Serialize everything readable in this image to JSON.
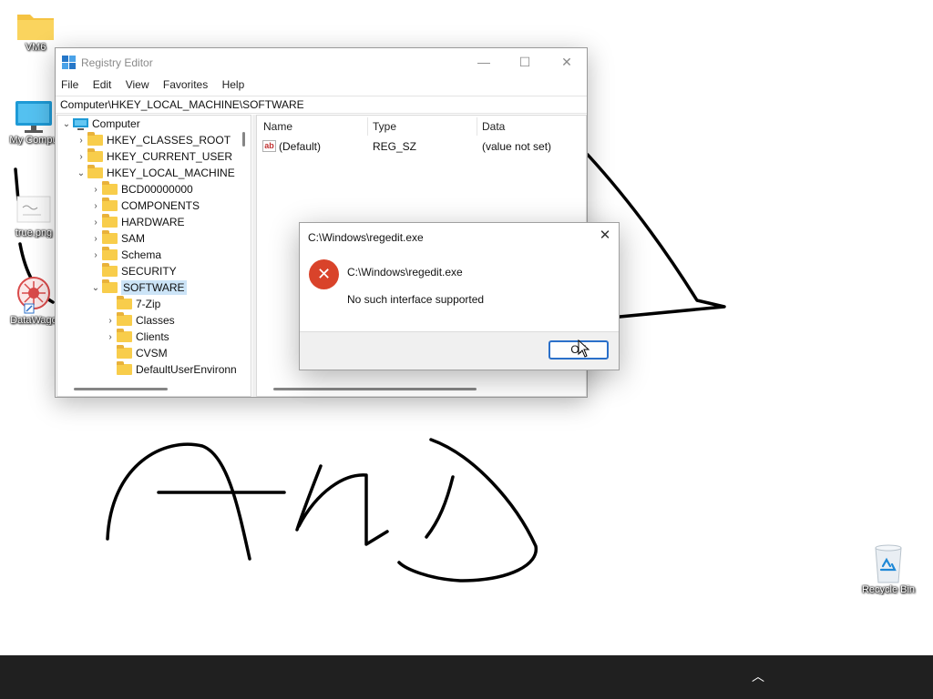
{
  "desktop": {
    "icons": [
      {
        "label": "VM6"
      },
      {
        "label": "My Compu"
      },
      {
        "label": "true.png"
      },
      {
        "label": "DataWago"
      },
      {
        "label": "Recycle Bin"
      }
    ]
  },
  "regedit": {
    "title": "Registry Editor",
    "window_buttons": {
      "minimize": "—",
      "maximize": "☐",
      "close": "✕"
    },
    "menu": [
      "File",
      "Edit",
      "View",
      "Favorites",
      "Help"
    ],
    "address": "Computer\\HKEY_LOCAL_MACHINE\\SOFTWARE",
    "tree": [
      {
        "label": "Computer",
        "chevron": "⌄"
      },
      {
        "label": "HKEY_CLASSES_ROOT",
        "chevron": "›"
      },
      {
        "label": "HKEY_CURRENT_USER",
        "chevron": "›"
      },
      {
        "label": "HKEY_LOCAL_MACHINE",
        "chevron": "⌄"
      },
      {
        "label": "BCD00000000",
        "chevron": "›"
      },
      {
        "label": "COMPONENTS",
        "chevron": "›"
      },
      {
        "label": "HARDWARE",
        "chevron": "›"
      },
      {
        "label": "SAM",
        "chevron": "›"
      },
      {
        "label": "Schema",
        "chevron": "›"
      },
      {
        "label": "SECURITY",
        "chevron": ""
      },
      {
        "label": "SOFTWARE",
        "chevron": "⌄",
        "selected": true
      },
      {
        "label": "7-Zip",
        "chevron": ""
      },
      {
        "label": "Classes",
        "chevron": "›"
      },
      {
        "label": "Clients",
        "chevron": "›"
      },
      {
        "label": "CVSM",
        "chevron": ""
      },
      {
        "label": "DefaultUserEnvironn",
        "chevron": ""
      }
    ],
    "columns": {
      "name": "Name",
      "type": "Type",
      "data": "Data"
    },
    "values": [
      {
        "icon": "ab",
        "name": "(Default)",
        "type": "REG_SZ",
        "data": "(value not set)"
      }
    ]
  },
  "error_dialog": {
    "title": "C:\\Windows\\regedit.exe",
    "close": "✕",
    "icon": "✕",
    "heading": "C:\\Windows\\regedit.exe",
    "message": "No such interface supported",
    "ok_label": "OK"
  },
  "taskbar": {
    "tray_chevron": "︿",
    "background": "#202020"
  },
  "colors": {
    "selection": "#cce4f7",
    "error_red": "#d9432a",
    "focus_blue": "#2a6fc9",
    "folder_yellow": "#f8cd4b"
  }
}
